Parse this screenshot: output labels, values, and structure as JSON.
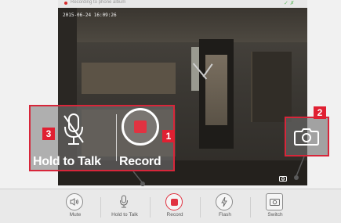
{
  "status_bar": {
    "recording_text": "Recording to phone album",
    "timestamp": "2015-06-24 16:09:26"
  },
  "overlay": {
    "hold_to_talk_label": "Hold to Talk",
    "record_label": "Record",
    "badges": [
      "3",
      "1",
      "2"
    ]
  },
  "toolbar": {
    "items": [
      {
        "label": "Mute",
        "icon": "speaker-icon"
      },
      {
        "label": "Hold to Talk",
        "icon": "microphone-icon"
      },
      {
        "label": "Record",
        "icon": "record-icon"
      },
      {
        "label": "Flash",
        "icon": "flash-icon"
      },
      {
        "label": "Switch",
        "icon": "camera-switch-icon"
      }
    ]
  },
  "colors": {
    "accent_red": "#e13241",
    "highlight_border": "#d7263a",
    "toolbar_bg": "#e9e9e9"
  }
}
